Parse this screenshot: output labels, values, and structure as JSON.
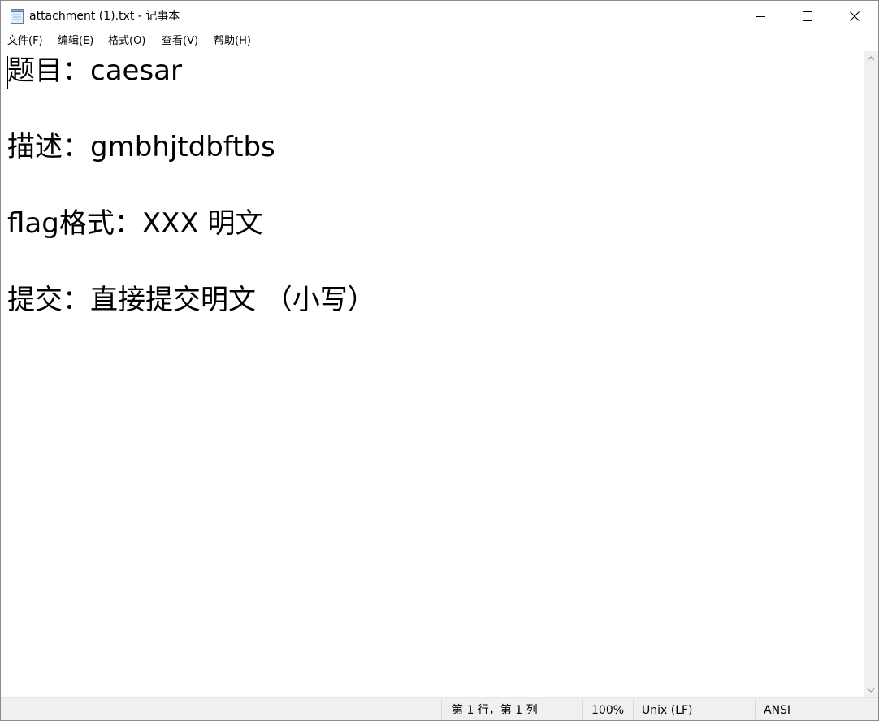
{
  "window": {
    "title": "attachment (1).txt - 记事本",
    "icon": "notepad-icon"
  },
  "titlebar_buttons": {
    "minimize_icon": "minimize-icon",
    "maximize_icon": "maximize-icon",
    "close_icon": "close-icon"
  },
  "menu": {
    "items": [
      {
        "label": "文件(F)"
      },
      {
        "label": "编辑(E)"
      },
      {
        "label": "格式(O)"
      },
      {
        "label": "查看(V)"
      },
      {
        "label": "帮助(H)"
      }
    ]
  },
  "editor": {
    "lines": [
      "题目：caesar",
      "描述：gmbhjtdbftbs",
      "flag格式：XXX 明文",
      "提交：直接提交明文 （小写）"
    ]
  },
  "statusbar": {
    "position": "第 1 行，第 1 列",
    "zoom": "100%",
    "line_ending": "Unix (LF)",
    "encoding": "ANSI"
  },
  "colors": {
    "text": "#000000",
    "background": "#ffffff",
    "chrome": "#f0f0f0"
  }
}
